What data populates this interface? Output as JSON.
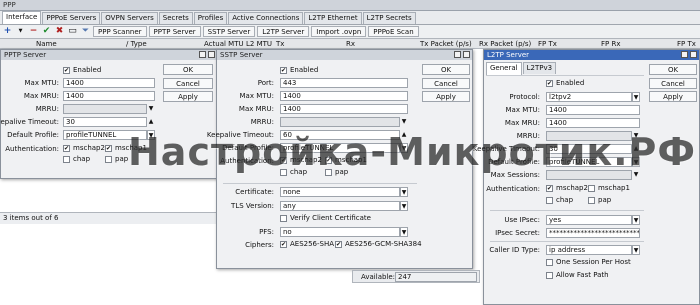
{
  "app": {
    "title": "PPP"
  },
  "tabs": [
    "Interface",
    "PPPoE Servers",
    "OVPN Servers",
    "Secrets",
    "Profiles",
    "Active Connections",
    "L2TP Ethernet",
    "L2TP Secrets"
  ],
  "toolbar": {
    "buttons": [
      "PPP Scanner",
      "PPTP Server",
      "SSTP Server",
      "L2TP Server",
      "Import .ovpn",
      "PPPoE Scan"
    ]
  },
  "columns": [
    "Name",
    "Type",
    "Actual MTU",
    "L2 MTU",
    "Tx",
    "Rx",
    "Tx Packet (p/s)",
    "Rx Packet (p/s)",
    "FP Tx",
    "FP Rx",
    "FP Tx"
  ],
  "status": {
    "items_text": "3 items out of 6"
  },
  "pptp": {
    "title": "PPTP Server",
    "enabled_label": "Enabled",
    "max_mtu_label": "Max MTU:",
    "max_mtu": "1400",
    "max_mru_label": "Max MRU:",
    "max_mru": "1400",
    "mrru_label": "MRRU:",
    "keepalive_label": "Keepalive Timeout:",
    "keepalive": "30",
    "profile_label": "Default Profile:",
    "profile": "profileTUNNEL",
    "auth_label": "Authentication:",
    "auth": [
      "mschap2",
      "mschap1",
      "chap",
      "pap"
    ],
    "ok": "OK",
    "cancel": "Cancel",
    "apply": "Apply"
  },
  "sstp": {
    "title": "SSTP Server",
    "enabled_label": "Enabled",
    "port_label": "Port:",
    "port": "443",
    "max_mtu_label": "Max MTU:",
    "max_mtu": "1400",
    "max_mru_label": "Max MRU:",
    "max_mru": "1400",
    "mrru_label": "MRRU:",
    "keepalive_label": "Keepalive Timeout:",
    "keepalive": "60",
    "profile_label": "Default Profile:",
    "profile": "profileTUNNEL",
    "auth_label": "Authentication:",
    "auth": [
      "mschap2",
      "mschap1",
      "chap",
      "pap"
    ],
    "certificate_label": "Certificate:",
    "certificate": "none",
    "tls_label": "TLS Version:",
    "tls": "any",
    "verify_label": "Verify Client Certificate",
    "pfs_label": "PFS:",
    "pfs": "no",
    "ciphers_label": "Ciphers:",
    "ciphers": [
      "AES256-SHA",
      "AES256-GCM-SHA384"
    ],
    "available_label": "Available:",
    "available": "247",
    "ok": "OK",
    "cancel": "Cancel",
    "apply": "Apply"
  },
  "l2tp": {
    "title": "L2TP Server",
    "tabs": [
      "General",
      "L2TPv3"
    ],
    "enabled_label": "Enabled",
    "protocol_label": "Protocol:",
    "protocol": "l2tpv2",
    "max_mtu_label": "Max MTU:",
    "max_mtu": "1400",
    "max_mru_label": "Max MRU:",
    "max_mru": "1400",
    "mrru_label": "MRRU:",
    "keepalive_label": "Keepalive Timeout:",
    "keepalive": "30",
    "profile_label": "Default Profile:",
    "profile": "profileTUNNEL",
    "max_sessions_label": "Max Sessions:",
    "auth_label": "Authentication:",
    "auth": [
      "mschap2",
      "mschap1",
      "chap",
      "pap"
    ],
    "use_ipsec_label": "Use IPsec:",
    "use_ipsec": "yes",
    "ipsec_secret_label": "IPsec Secret:",
    "ipsec_secret": "**************************",
    "caller_id_label": "Caller ID Type:",
    "caller_id": "ip address",
    "one_session_label": "One Session Per Host",
    "allow_fast_path_label": "Allow Fast Path",
    "ok": "OK",
    "cancel": "Cancel",
    "apply": "Apply"
  },
  "watermark": "Настройка-Микротик.РФ"
}
